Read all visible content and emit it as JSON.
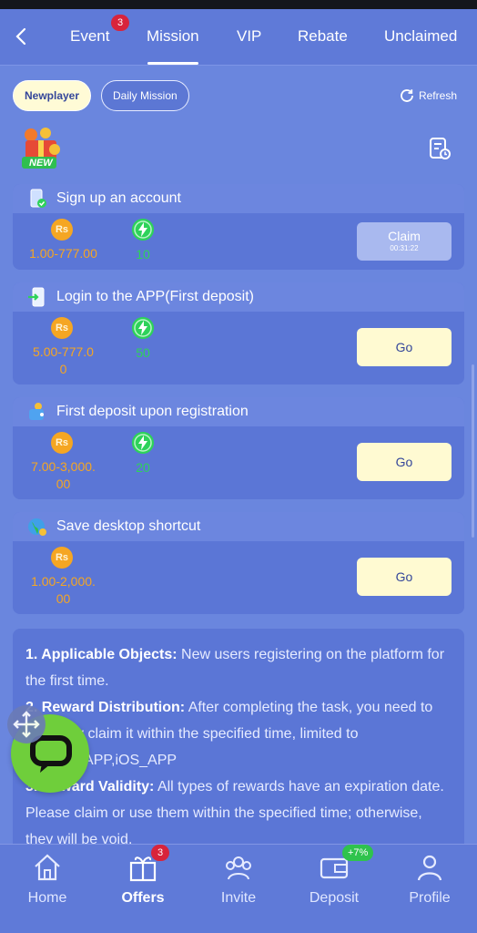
{
  "topnav": {
    "tabs": [
      {
        "label": "Event",
        "badge": "3"
      },
      {
        "label": "Mission",
        "active": true
      },
      {
        "label": "VIP"
      },
      {
        "label": "Rebate"
      },
      {
        "label": "Unclaimed"
      }
    ]
  },
  "subnav": {
    "pills": [
      "Newplayer",
      "Daily Mission"
    ],
    "refresh_label": "Refresh"
  },
  "gift_badge": "NEW",
  "missions": [
    {
      "title": "Sign up an account",
      "coin_symbol": "Rs",
      "amount": "1.00-777.00",
      "points": "10",
      "button": "Claim",
      "timer": "00:31:22"
    },
    {
      "title": "Login to the APP(First deposit)",
      "coin_symbol": "Rs",
      "amount_lines": [
        "5.00-777.0",
        "0"
      ],
      "points": "50",
      "button": "Go"
    },
    {
      "title": "First deposit upon registration",
      "coin_symbol": "Rs",
      "amount_lines": [
        "7.00-3,000.",
        "00"
      ],
      "points": "20",
      "button": "Go"
    },
    {
      "title": "Save desktop shortcut",
      "coin_symbol": "Rs",
      "amount_lines": [
        "1.00-2,000.",
        "00"
      ],
      "button": "Go"
    }
  ],
  "rules": {
    "r1_label": "1. Applicable Objects:",
    "r1_text": " New users registering on the platform for the first time.",
    "r2_label": "2. Reward Distribution:",
    "r2_text": " After completing the task, you need to manually claim it within the specified time, limited to Android_APP,iOS_APP",
    "r3_label": "3. Reward Validity:",
    "r3_text": " All types of rewards have an expiration date. Please claim or use them within the specified time; otherwise, they will be void."
  },
  "bottombar": {
    "items": [
      "Home",
      "Offers",
      "Invite",
      "Deposit",
      "Profile"
    ],
    "offers_badge": "3",
    "deposit_badge": "+7%"
  },
  "colors": {
    "background": "#6a86de",
    "gold": "#f5a623",
    "green": "#2ed25a",
    "button": "#fffad2"
  }
}
